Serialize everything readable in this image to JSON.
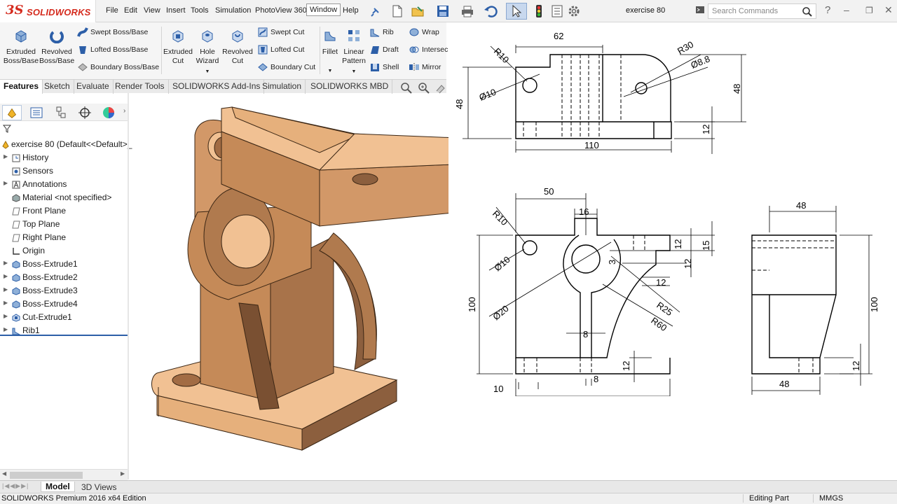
{
  "app": {
    "brand_ds": "3S",
    "brand_name": "SOLIDWORKS",
    "document_title": "exercise 80"
  },
  "menu": [
    "File",
    "Edit",
    "View",
    "Insert",
    "Tools",
    "Simulation",
    "PhotoView 360",
    "Window",
    "Help"
  ],
  "search": {
    "placeholder": "Search Commands"
  },
  "ribbon": {
    "extruded_boss": [
      "Extruded",
      "Boss/Base"
    ],
    "revolved_boss": [
      "Revolved",
      "Boss/Base"
    ],
    "swept_boss": "Swept Boss/Base",
    "lofted_boss": "Lofted Boss/Base",
    "boundary_boss": "Boundary Boss/Base",
    "extruded_cut": [
      "Extruded",
      "Cut"
    ],
    "hole_wizard": [
      "Hole",
      "Wizard"
    ],
    "revolved_cut": [
      "Revolved",
      "Cut"
    ],
    "swept_cut": "Swept Cut",
    "lofted_cut": "Lofted Cut",
    "boundary_cut": "Boundary Cut",
    "fillet": "Fillet",
    "linear_pattern": [
      "Linear",
      "Pattern"
    ],
    "rib": "Rib",
    "draft": "Draft",
    "shell": "Shell",
    "wrap": "Wrap",
    "intersect": "Intersec",
    "mirror": "Mirror"
  },
  "tabs": [
    "Features",
    "Sketch",
    "Evaluate",
    "Render Tools",
    "SOLIDWORKS Add-Ins",
    "Simulation",
    "SOLIDWORKS MBD"
  ],
  "tree": {
    "root": "exercise 80  (Default<<Default>_",
    "items": [
      "History",
      "Sensors",
      "Annotations",
      "Material <not specified>",
      "Front Plane",
      "Top Plane",
      "Right Plane",
      "Origin",
      "Boss-Extrude1",
      "Boss-Extrude2",
      "Boss-Extrude3",
      "Boss-Extrude4",
      "Cut-Extrude1",
      "Rib1"
    ]
  },
  "bottom_tabs": [
    "Model",
    "3D Views"
  ],
  "status": {
    "edition": "SOLIDWORKS Premium 2016 x64 Edition",
    "mode": "Editing Part",
    "units": "MMGS"
  },
  "drawing": {
    "top": {
      "w62": "62",
      "r10": "R10",
      "r30": "R30",
      "d88": "Ø8.8",
      "d10": "Ø10",
      "h48l": "48",
      "h48r": "48",
      "h12": "12",
      "w110": "110"
    },
    "front": {
      "w50": "50",
      "w16": "16",
      "r10": "R10",
      "d10": "Ø10",
      "d20": "Ø20",
      "h100": "100",
      "h12a": "12",
      "h15": "15",
      "h12b": "12",
      "d3": "3",
      "w12": "12",
      "r25": "R25",
      "r60": "R60",
      "w8a": "8",
      "h12c": "12",
      "w8b": "8",
      "w10": "10",
      "w62": "62"
    },
    "side": {
      "w48t": "48",
      "h100": "100",
      "h12": "12",
      "w48b": "48"
    }
  },
  "colors": {
    "accent": "#d52b1e",
    "part_face_light": "#f1c193",
    "part_face_mid": "#d29868",
    "part_face_dark": "#8c5f3e"
  }
}
